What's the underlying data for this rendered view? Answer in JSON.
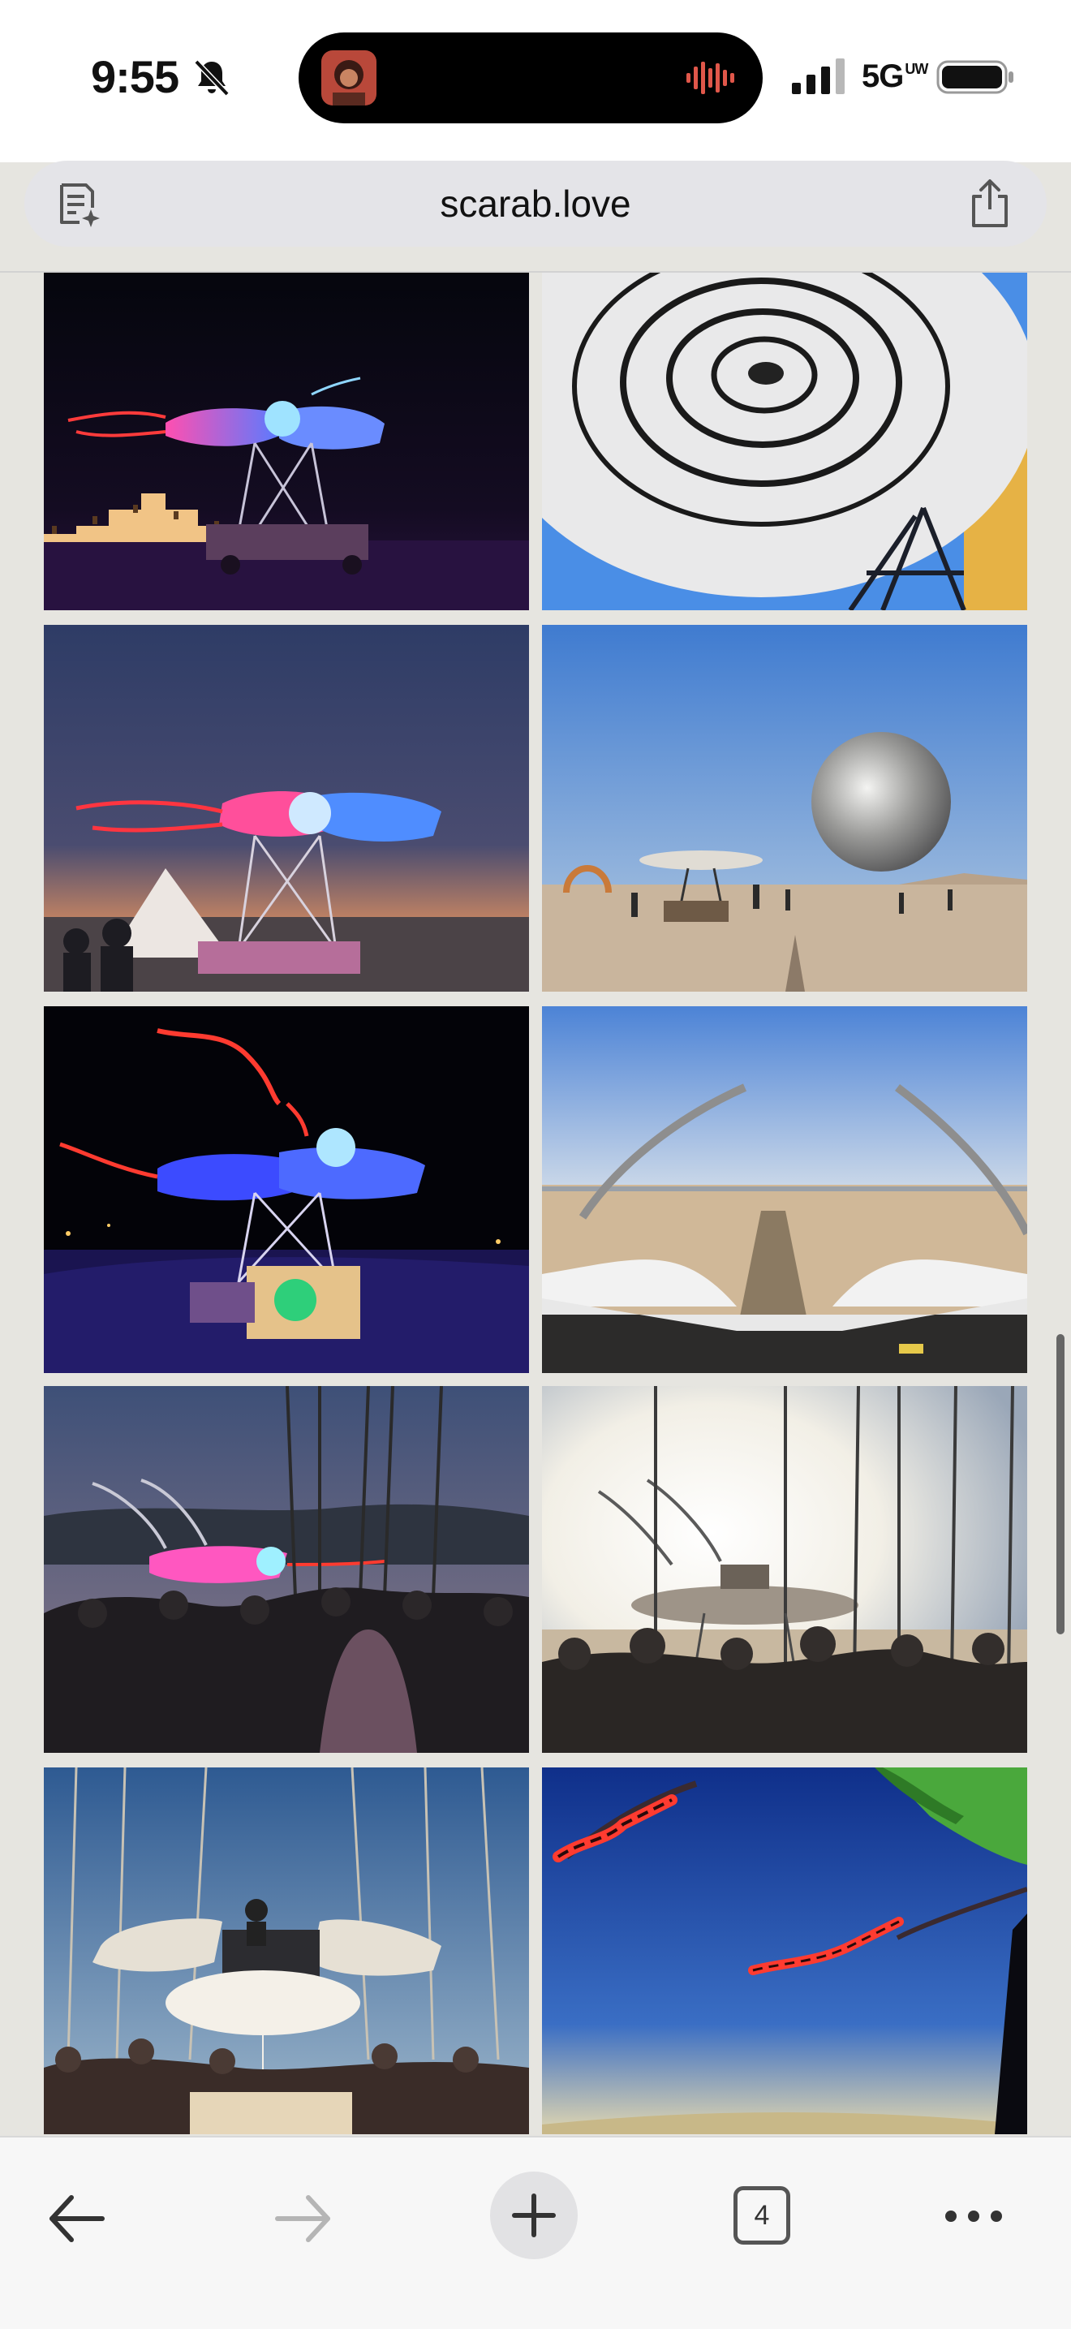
{
  "status_bar": {
    "time": "9:55",
    "network": "5G",
    "network_suffix": "UW",
    "icons": [
      "bell-slash-icon",
      "signal-bars-icon",
      "battery-icon",
      "audio-wave-icon"
    ]
  },
  "browser": {
    "url": "scarab.love",
    "open_tab_count": "4",
    "icons": [
      "reader-mode-icon",
      "share-icon",
      "back-arrow-icon",
      "forward-arrow-icon",
      "plus-icon",
      "tabs-icon",
      "more-icon"
    ]
  },
  "gallery": {
    "photos": [
      "scarab art car glowing pink and blue at night with lit temple behind",
      "white spiral canopy against blue sky",
      "scarab art car at dusk with pink and blue lights among tents",
      "scarab art car beside giant silver sphere on the playa",
      "scarab art car glowing blue and red at night",
      "view from scarab deck with antennae over the desert",
      "scarab art car at twilight with a crowd and mountains",
      "scarab art car backlit by the sun with a crowd",
      "dj on the scarab under a canopy with a crowd",
      "red antenna tips and green wing against blue sky"
    ]
  },
  "colors": {
    "page_background": "#e6e5e0",
    "toolbar_background": "#f7f7f7",
    "url_bar_background": "#e4e4e8"
  }
}
